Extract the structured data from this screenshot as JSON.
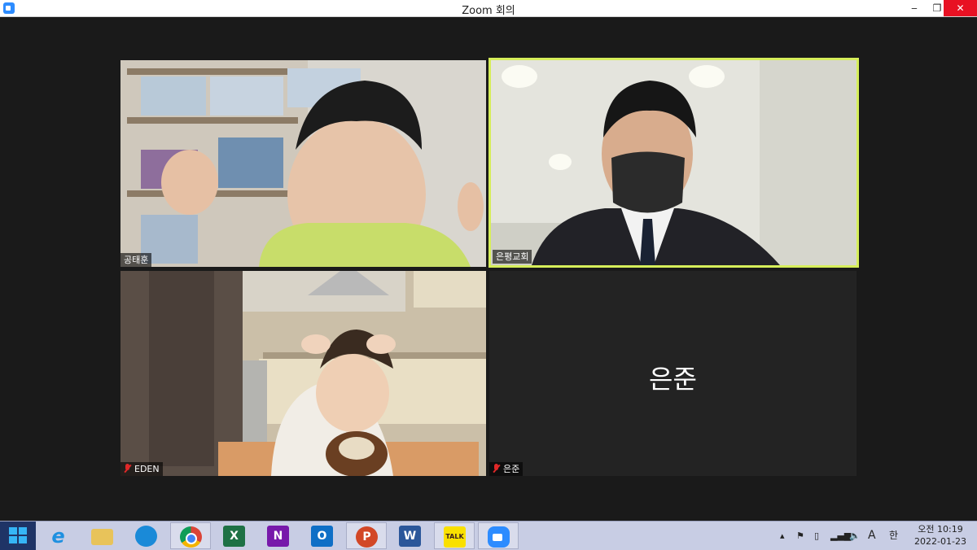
{
  "window": {
    "title": "Zoom 회의",
    "controls": {
      "minimize": "‒",
      "maximize": "❐",
      "close": "✕"
    }
  },
  "participants": [
    {
      "name": "공태훈",
      "muted": false,
      "active_speaker": false,
      "video": true
    },
    {
      "name": "은평교회",
      "muted": false,
      "active_speaker": true,
      "video": true
    },
    {
      "name": "EDEN",
      "muted": true,
      "active_speaker": false,
      "video": true
    },
    {
      "name": "은준",
      "muted": true,
      "active_speaker": false,
      "video": false,
      "display_name_large": "은준"
    }
  ],
  "taskbar": {
    "apps": [
      {
        "name": "internet-explorer-icon",
        "label": "e",
        "color": "#1e90e0"
      },
      {
        "name": "file-explorer-icon",
        "label": "",
        "color": "#e8c35a"
      },
      {
        "name": "edge-icon",
        "label": "",
        "color": "#1a8ad8"
      },
      {
        "name": "chrome-icon",
        "label": "",
        "color": "#e04a3a"
      },
      {
        "name": "excel-icon",
        "label": "X",
        "color": "#1e7145"
      },
      {
        "name": "onenote-icon",
        "label": "N",
        "color": "#7719aa"
      },
      {
        "name": "outlook-icon",
        "label": "O",
        "color": "#0f6fc6"
      },
      {
        "name": "powerpoint-icon",
        "label": "P",
        "color": "#d24726"
      },
      {
        "name": "word-icon",
        "label": "W",
        "color": "#2b579a"
      },
      {
        "name": "kakaotalk-icon",
        "label": "TALK",
        "color": "#f9e000"
      },
      {
        "name": "zoom-icon",
        "label": "",
        "color": "#2d8cff"
      }
    ],
    "tray": {
      "ime_mode": "A",
      "ime_lang": "한",
      "time": "오전 10:19",
      "date": "2022-01-23"
    }
  },
  "colors": {
    "active_speaker_border": "#d6ee5a",
    "muted_icon": "#e02828",
    "taskbar_bg": "#c8cde4",
    "start_bg": "#1f3466"
  }
}
